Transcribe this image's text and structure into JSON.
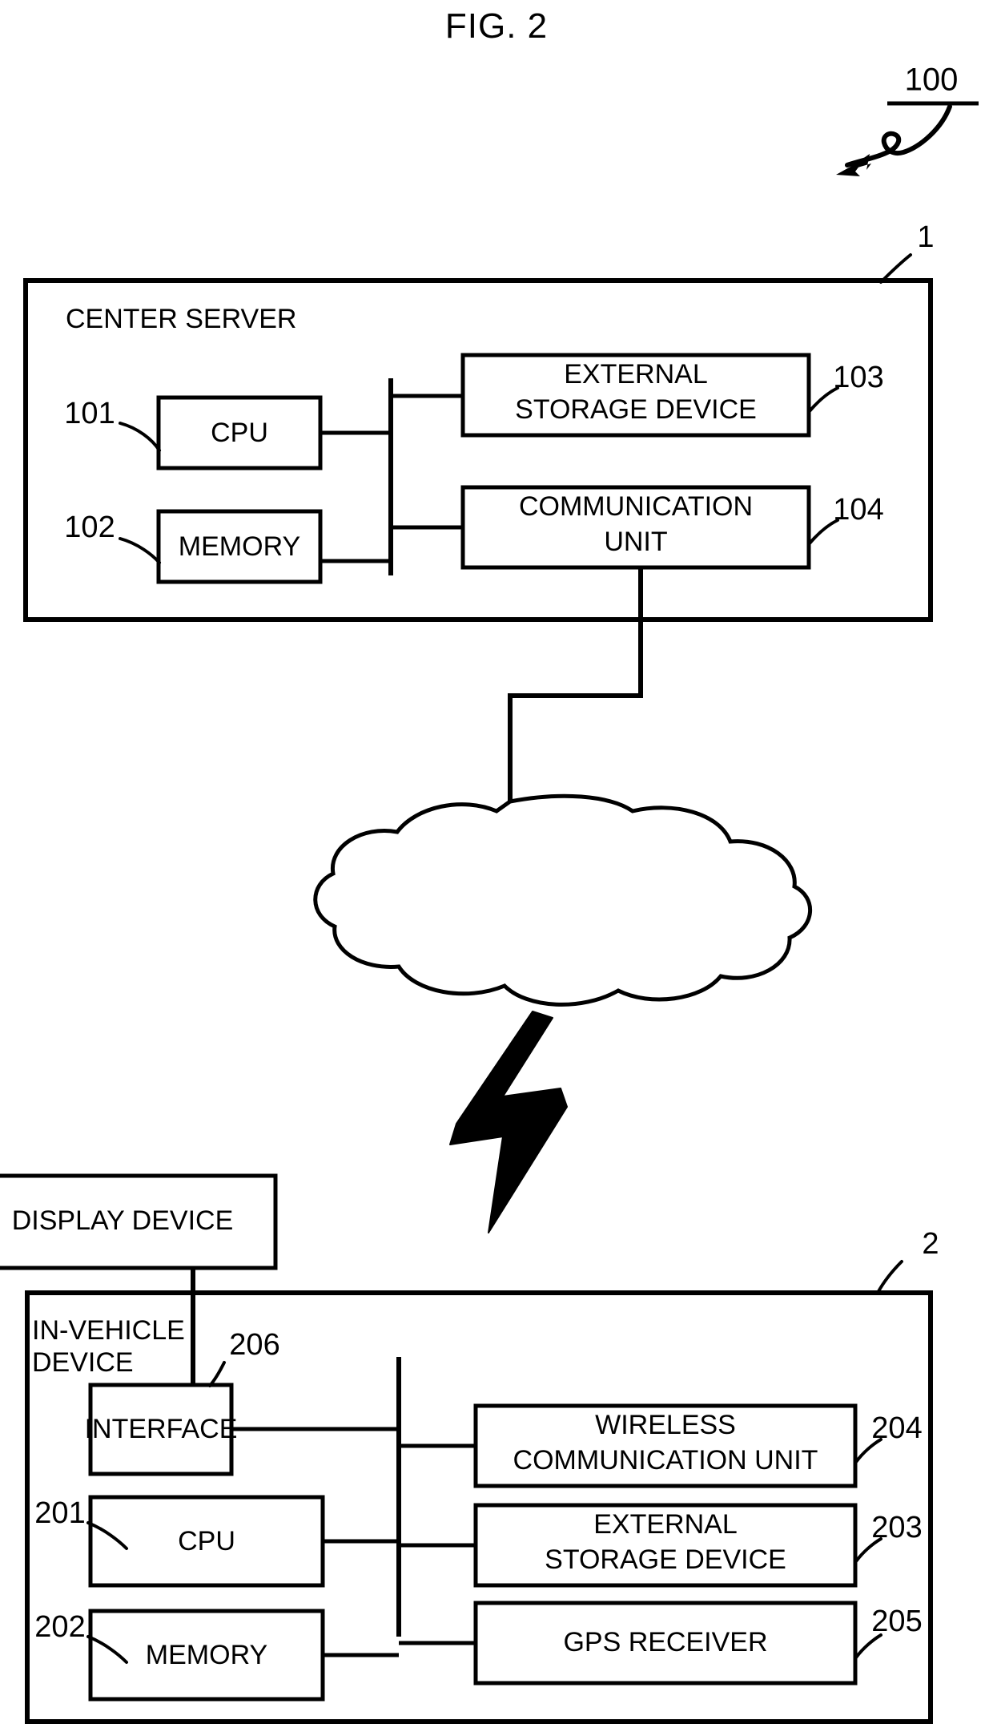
{
  "figure": {
    "title": "FIG. 2",
    "system_ref": "100"
  },
  "center_server": {
    "title": "CENTER SERVER",
    "ref": "1",
    "components": [
      {
        "label": "CPU",
        "ref": "101"
      },
      {
        "label": "MEMORY",
        "ref": "102"
      },
      {
        "label_line1": "EXTERNAL",
        "label_line2": "STORAGE DEVICE",
        "ref": "103"
      },
      {
        "label_line1": "COMMUNICATION",
        "label_line2": "UNIT",
        "ref": "104"
      }
    ]
  },
  "network": {
    "cloud_name": "network-cloud",
    "wireless_name": "wireless-link-bolt"
  },
  "display_device": {
    "label": "DISPLAY DEVICE"
  },
  "in_vehicle_device": {
    "title_line1": "IN-VEHICLE",
    "title_line2": "DEVICE",
    "ref": "2",
    "components": [
      {
        "label": "INTERFACE",
        "ref": "206"
      },
      {
        "label": "CPU",
        "ref": "201"
      },
      {
        "label": "MEMORY",
        "ref": "202"
      },
      {
        "label_line1": "WIRELESS",
        "label_line2": "COMMUNICATION UNIT",
        "ref": "204"
      },
      {
        "label_line1": "EXTERNAL",
        "label_line2": "STORAGE DEVICE",
        "ref": "203"
      },
      {
        "label": "GPS RECEIVER",
        "ref": "205"
      }
    ]
  },
  "colors": {
    "ink": "#000000",
    "paper": "#ffffff"
  }
}
